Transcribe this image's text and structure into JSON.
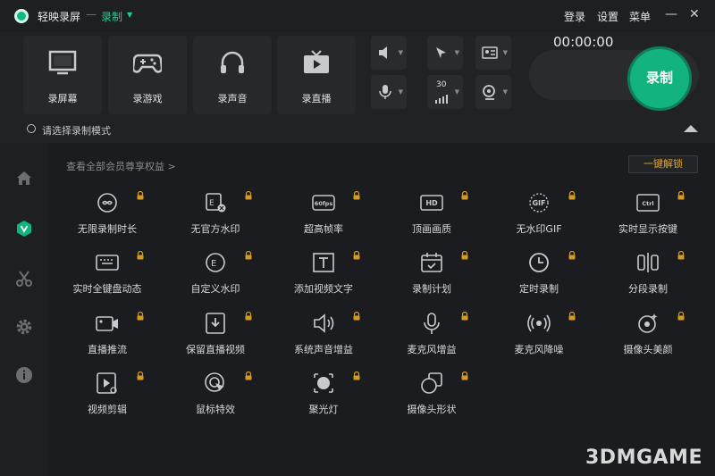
{
  "app": {
    "title": "轻映录屏",
    "separator": "—",
    "mode": "录制"
  },
  "menu": {
    "login": "登录",
    "settings": "设置",
    "menu": "菜单"
  },
  "window": {
    "minimize": "—",
    "close": "✕"
  },
  "record_modes": [
    "录屏幕",
    "录游戏",
    "录声音",
    "录直播"
  ],
  "small_controls": {
    "fps_value": "30"
  },
  "timer": "00:00:00",
  "record_button": "录制",
  "mode_hint": "请选择录制模式",
  "privilege_link": "查看全部会员尊享权益 >",
  "unlock_button": "一键解锁",
  "features": [
    {
      "label": "无限录制时长",
      "icon": "infinity-icon"
    },
    {
      "label": "无官方水印",
      "icon": "no-watermark-icon"
    },
    {
      "label": "超高帧率",
      "icon": "60fps-icon",
      "badge": "60fps"
    },
    {
      "label": "顶画画质",
      "icon": "hd-icon",
      "badge": "HD"
    },
    {
      "label": "无水印GIF",
      "icon": "gif-icon",
      "badge": "GIF"
    },
    {
      "label": "实时显示按键",
      "icon": "ctrl-key-icon",
      "badge": "Ctrl"
    },
    {
      "label": "实时全键盘动态",
      "icon": "keyboard-icon"
    },
    {
      "label": "自定义水印",
      "icon": "custom-watermark-icon"
    },
    {
      "label": "添加视频文字",
      "icon": "text-icon"
    },
    {
      "label": "录制计划",
      "icon": "calendar-check-icon"
    },
    {
      "label": "定时录制",
      "icon": "clock-icon"
    },
    {
      "label": "分段录制",
      "icon": "split-icon"
    },
    {
      "label": "直播推流",
      "icon": "live-camera-icon"
    },
    {
      "label": "保留直播视频",
      "icon": "download-video-icon"
    },
    {
      "label": "系统声音增益",
      "icon": "speaker-icon"
    },
    {
      "label": "麦克风增益",
      "icon": "microphone-icon"
    },
    {
      "label": "麦克风降噪",
      "icon": "noise-reduction-icon"
    },
    {
      "label": "摄像头美颜",
      "icon": "beauty-camera-icon"
    },
    {
      "label": "视频剪辑",
      "icon": "video-edit-icon"
    },
    {
      "label": "鼠标特效",
      "icon": "cursor-effect-icon"
    },
    {
      "label": "聚光灯",
      "icon": "spotlight-icon"
    },
    {
      "label": "摄像头形状",
      "icon": "camera-shape-icon"
    }
  ],
  "watermark": "3DMGAME"
}
